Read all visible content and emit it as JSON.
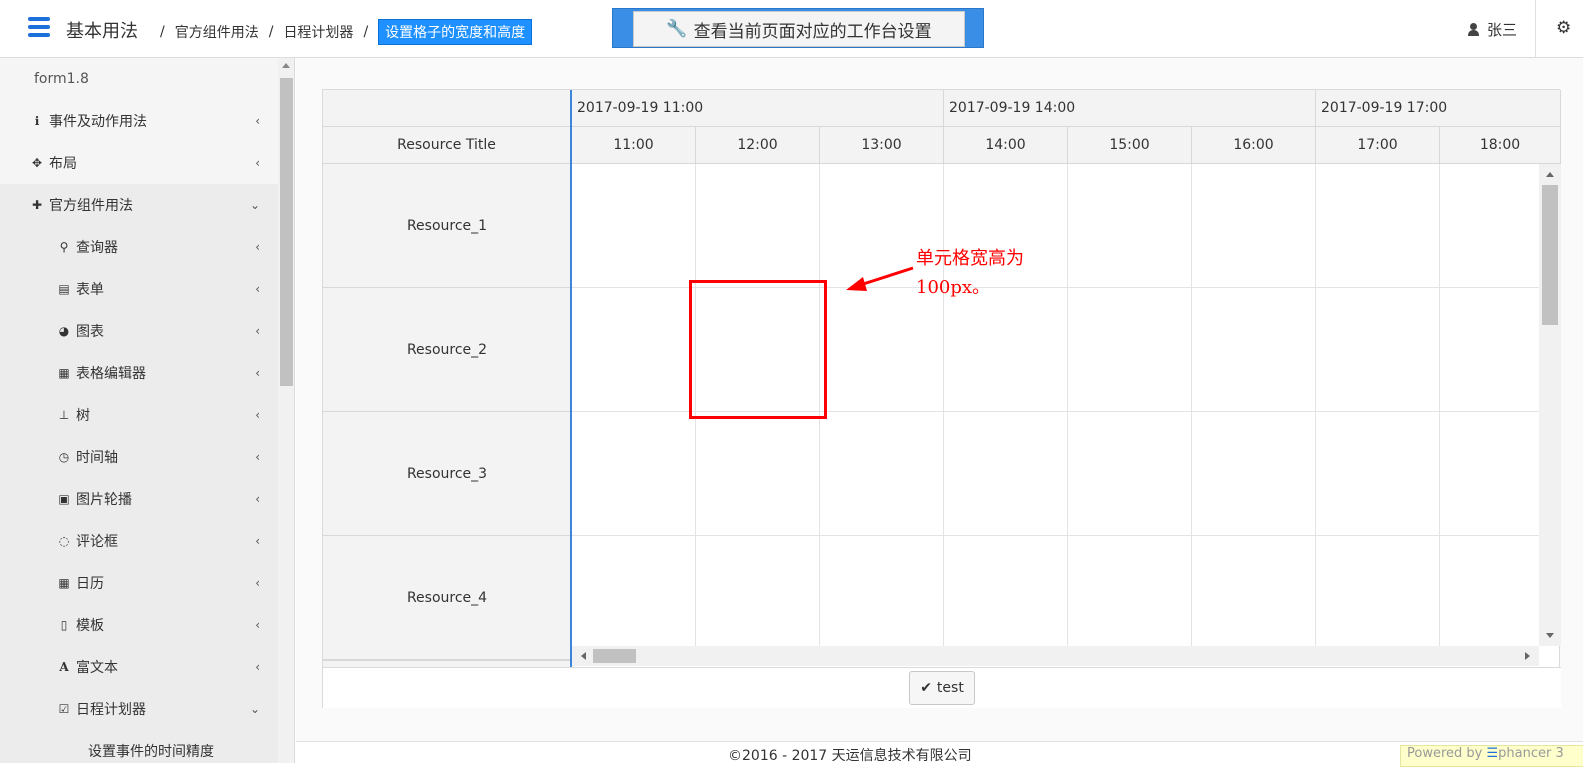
{
  "header": {
    "app_title": "基本用法",
    "breadcrumb": [
      "官方组件用法",
      "日程计划器",
      "设置格子的宽度和高度"
    ],
    "workbench_button": "查看当前页面对应的工作台设置",
    "user_name": "张三"
  },
  "sidebar": {
    "brand": "form1.8",
    "items": [
      {
        "label": "事件及动作用法",
        "icon": "info-circle-icon"
      },
      {
        "label": "布局",
        "icon": "move-icon"
      },
      {
        "label": "官方组件用法",
        "icon": "puzzle-icon",
        "open": true
      }
    ],
    "subitems": [
      {
        "label": "查询器",
        "icon": "search-icon"
      },
      {
        "label": "表单",
        "icon": "form-icon"
      },
      {
        "label": "图表",
        "icon": "pie-chart-icon"
      },
      {
        "label": "表格编辑器",
        "icon": "table-icon"
      },
      {
        "label": "树",
        "icon": "sitemap-icon"
      },
      {
        "label": "时间轴",
        "icon": "clock-icon"
      },
      {
        "label": "图片轮播",
        "icon": "image-icon"
      },
      {
        "label": "评论框",
        "icon": "comment-icon"
      },
      {
        "label": "日历",
        "icon": "calendar-icon"
      },
      {
        "label": "模板",
        "icon": "file-code-icon"
      },
      {
        "label": "富文本",
        "icon": "font-icon"
      },
      {
        "label": "日程计划器",
        "icon": "calendar-check-icon",
        "open": true
      }
    ],
    "sub_sub_item": "设置事件的时间精度"
  },
  "scheduler": {
    "resource_column_title": "Resource Title",
    "days": [
      "2017-09-19 11:00",
      "2017-09-19 14:00",
      "2017-09-19 17:00"
    ],
    "hours": [
      "11:00",
      "12:00",
      "13:00",
      "14:00",
      "15:00",
      "16:00",
      "17:00",
      "18:00"
    ],
    "resources": [
      "Resource_1",
      "Resource_2",
      "Resource_3",
      "Resource_4"
    ]
  },
  "annotation": {
    "line1": "单元格宽高为",
    "line2": "100px。",
    "color": "#ff0000"
  },
  "actions": {
    "test_button": "test"
  },
  "footer": {
    "copyright": "©2016 - 2017 天运信息技术有限公司",
    "powered_prefix": "Powered by ",
    "powered_brand": "phancer 3"
  },
  "colors": {
    "accent": "#1e90ff",
    "workbench_frame": "#3a8ee6",
    "timeline_marker": "#3b86d8"
  }
}
